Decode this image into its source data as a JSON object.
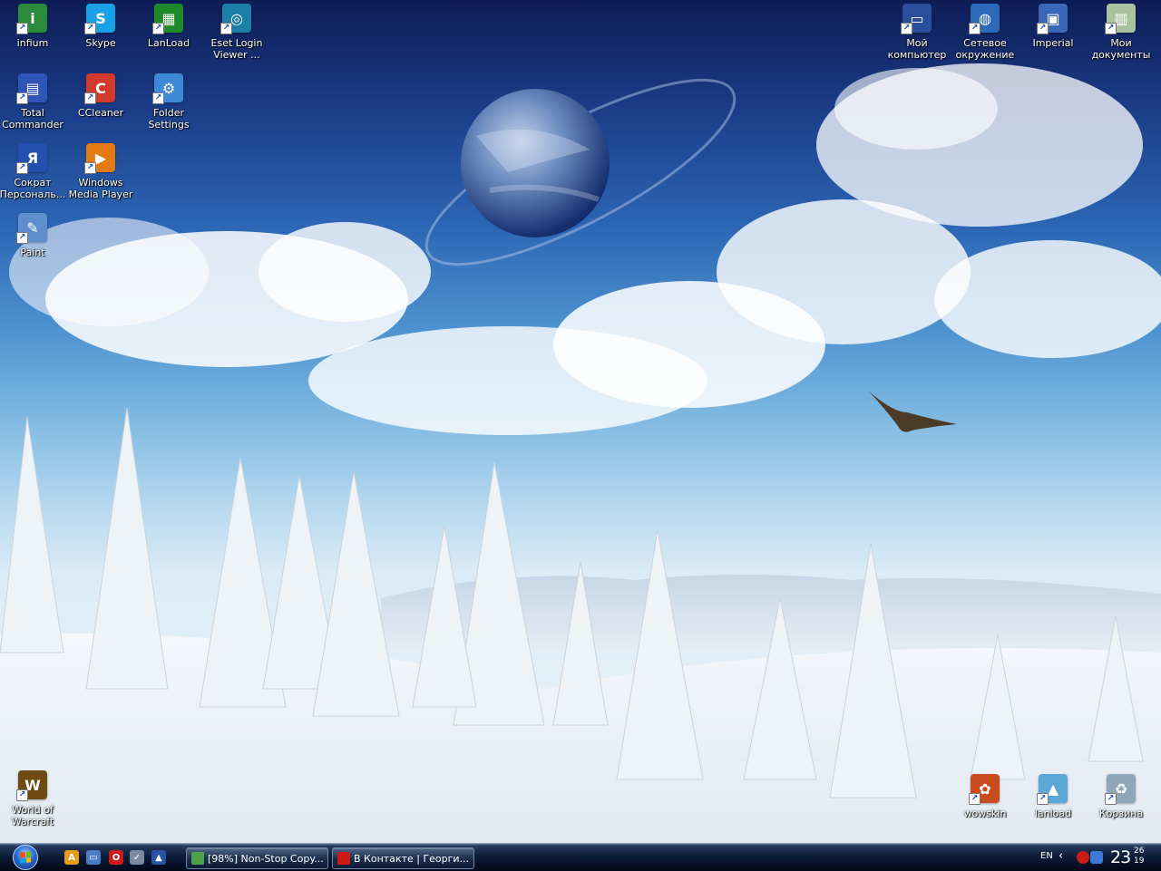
{
  "desktop": {
    "icons_left": [
      {
        "name": "infium-icon",
        "label": "infium",
        "color": "#2a8c3a",
        "glyph": "i"
      },
      {
        "name": "skype-icon",
        "label": "Skype",
        "color": "#1aa0e4",
        "glyph": "S"
      },
      {
        "name": "lanload-icon",
        "label": "LanLoad",
        "color": "#1d8a2c",
        "glyph": "▦"
      },
      {
        "name": "eset-icon",
        "label": "Eset Login Viewer ...",
        "color": "#1b7fa8",
        "glyph": "◎"
      },
      {
        "name": "total-commander-icon",
        "label": "Total Commander",
        "color": "#2f55b8",
        "glyph": "▤"
      },
      {
        "name": "ccleaner-icon",
        "label": "CCleaner",
        "color": "#d0392c",
        "glyph": "C"
      },
      {
        "name": "folder-settings-icon",
        "label": "Folder Settings",
        "color": "#3e88d8",
        "glyph": "⚙"
      },
      {
        "name": "sokrat-icon",
        "label": "Сократ Персональ...",
        "color": "#2450b0",
        "glyph": "Я"
      },
      {
        "name": "windows-media-player-icon",
        "label": "Windows Media Player",
        "color": "#e47a12",
        "glyph": "▶"
      },
      {
        "name": "paint-icon",
        "label": "Paint",
        "color": "#5d8fce",
        "glyph": "✎"
      },
      {
        "name": "world-of-warcraft-icon",
        "label": "World of Warcraft",
        "color": "#6d4b12",
        "glyph": "W"
      }
    ],
    "icons_right": [
      {
        "name": "my-computer-icon",
        "label": "Мой компьютер",
        "color": "#2a4f9d",
        "glyph": "▭"
      },
      {
        "name": "network-icon",
        "label": "Сетевое окружение",
        "color": "#2c6ab9",
        "glyph": "◍"
      },
      {
        "name": "imperial-icon",
        "label": "Imperial",
        "color": "#3a68b8",
        "glyph": "▣"
      },
      {
        "name": "my-documents-icon",
        "label": "Мои документы",
        "color": "#a9c3a0",
        "glyph": "▥"
      },
      {
        "name": "wowskin-icon",
        "label": "wowskin",
        "color": "#c94c1e",
        "glyph": "✿"
      },
      {
        "name": "lanload-image-icon",
        "label": "lanload",
        "color": "#5aa7d8",
        "glyph": "▲"
      },
      {
        "name": "recycle-bin-icon",
        "label": "Корзина",
        "color": "#8fa5b8",
        "glyph": "♻"
      }
    ]
  },
  "taskbar": {
    "quick_launch": [
      {
        "name": "avast-icon",
        "color": "#e89a1a",
        "glyph": "A"
      },
      {
        "name": "show-desktop-icon",
        "color": "#4a7cc7",
        "glyph": "▭"
      },
      {
        "name": "opera-icon",
        "color": "#cc1a1a",
        "glyph": "O"
      },
      {
        "name": "tools-icon",
        "color": "#7a8aa0",
        "glyph": "✓"
      },
      {
        "name": "app-icon",
        "color": "#2b52a8",
        "glyph": "▲"
      }
    ],
    "tasks": [
      {
        "name": "task-nonstop-copy",
        "label": "[98%] Non-Stop Copy...",
        "color": "#4fa04a"
      },
      {
        "name": "task-vkontakte",
        "label": "В Контакте | Георги...",
        "color": "#cc1a1a"
      }
    ],
    "tray": {
      "language": "EN",
      "expand": "‹",
      "clock_hour": "23",
      "clock_minute": "26",
      "clock_second": "19"
    }
  }
}
